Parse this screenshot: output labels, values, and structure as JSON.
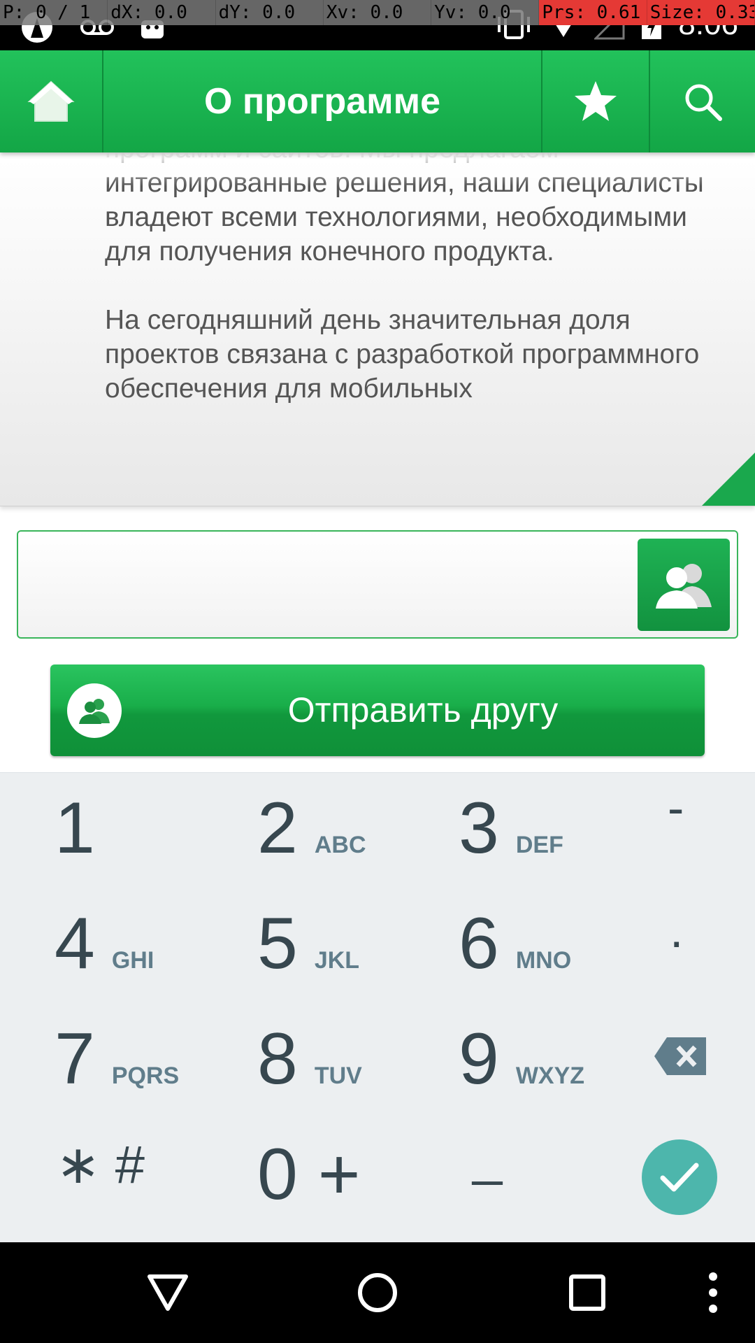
{
  "debug": {
    "cells": [
      "P: 0 / 1",
      "dX: 0.0",
      "dY: 0.0",
      "Xv: 0.0",
      "Yv: 0.0",
      "Prs: 0.61",
      "Size: 0.33"
    ]
  },
  "status": {
    "time": "8:06"
  },
  "header": {
    "title": "О программе"
  },
  "about": {
    "paragraphs": [
      "программ и сайтов. Мы предлагаем интегрированные решения, наши специалисты владеют всеми технологиями, необходимыми для получения конечного продукта.",
      "На сегодняшний день значительная доля проектов связана с разработкой программного обеспечения для мобильных"
    ]
  },
  "contact": {
    "value": "",
    "placeholder": ""
  },
  "send_button": {
    "label": "Отправить другу"
  },
  "keypad": {
    "keys": [
      {
        "digit": "1",
        "letters": ""
      },
      {
        "digit": "2",
        "letters": "ABC"
      },
      {
        "digit": "3",
        "letters": "DEF"
      },
      {
        "digit": "-",
        "letters": ""
      },
      {
        "digit": "4",
        "letters": "GHI"
      },
      {
        "digit": "5",
        "letters": "JKL"
      },
      {
        "digit": "6",
        "letters": "MNO"
      },
      {
        "digit": ".",
        "letters": ""
      },
      {
        "digit": "7",
        "letters": "PQRS"
      },
      {
        "digit": "8",
        "letters": "TUV"
      },
      {
        "digit": "9",
        "letters": "WXYZ"
      },
      {
        "digit": "∗ #",
        "letters": ""
      },
      {
        "digit": "0 +",
        "letters": ""
      },
      {
        "digit": "_",
        "letters": ""
      }
    ]
  },
  "colors": {
    "accent": "#1aa84d",
    "done_button": "#4db6ac",
    "key_text": "#37474f"
  }
}
